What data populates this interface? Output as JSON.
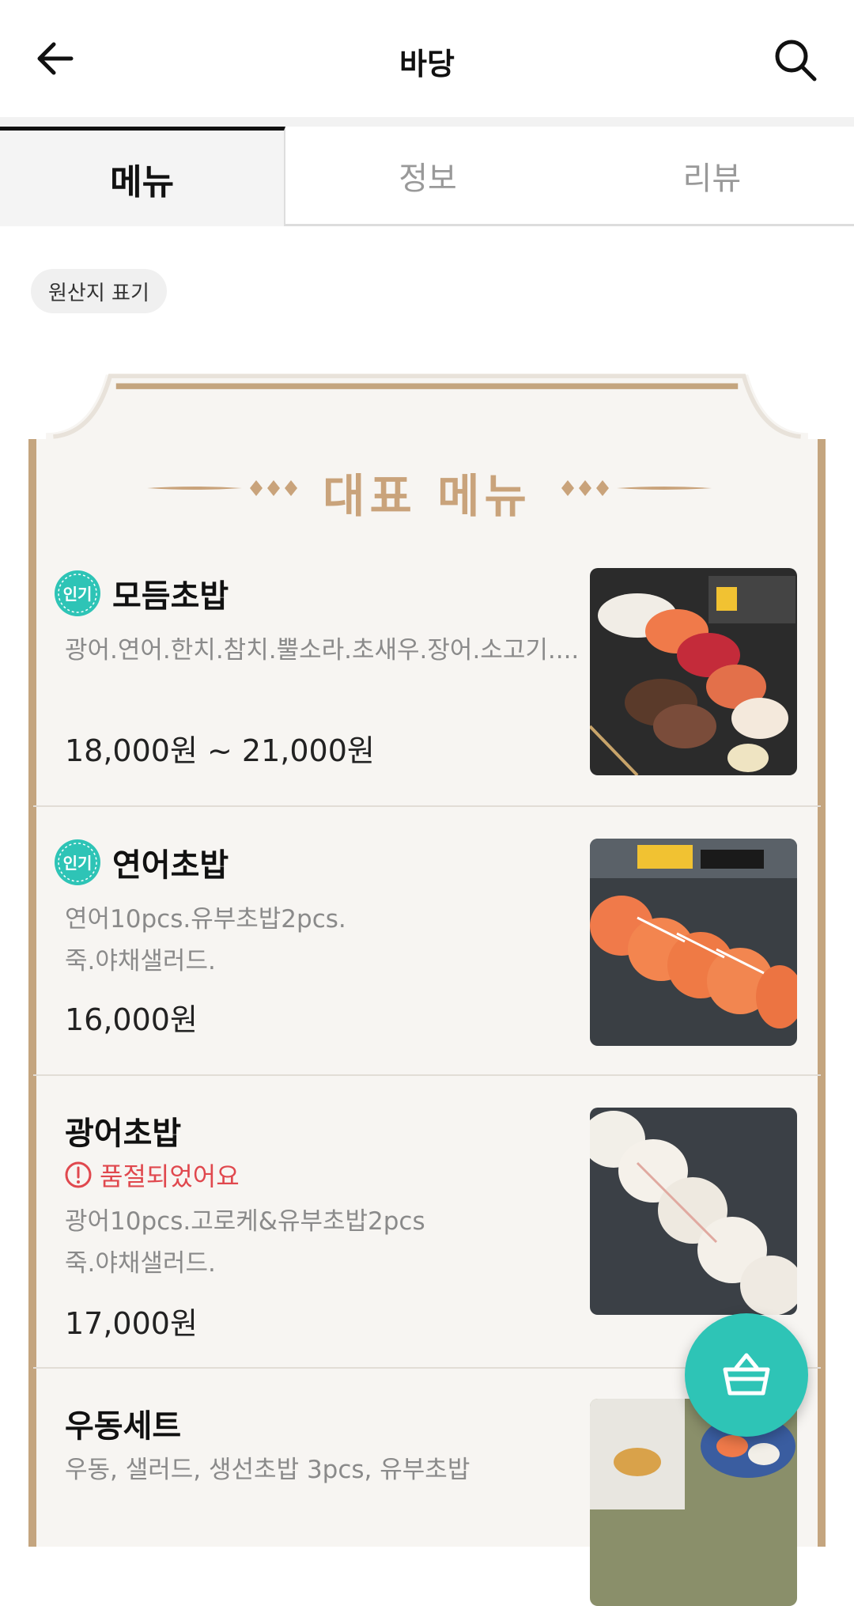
{
  "header": {
    "title": "바당",
    "back_icon": "arrow-left-icon",
    "search_icon": "search-icon"
  },
  "tabs": [
    {
      "label": "메뉴",
      "active": true
    },
    {
      "label": "정보",
      "active": false
    },
    {
      "label": "리뷰",
      "active": false
    }
  ],
  "origin_chip": {
    "label": "원산지 표기"
  },
  "section": {
    "title": "대표 메뉴"
  },
  "menu": [
    {
      "badge": "인기",
      "name": "모듬초밥",
      "desc": "광어.연어.한치.참치.뿔소라.초새우.장어.소고기....",
      "price": "18,000원 ~ 21,000원",
      "sold_out": false
    },
    {
      "badge": "인기",
      "name": "연어초밥",
      "desc": "연어10pcs.유부초밥2pcs.\n죽.야채샐러드.",
      "price": "16,000원",
      "sold_out": false
    },
    {
      "badge": "",
      "name": "광어초밥",
      "status": "품절되었어요",
      "desc": "광어10pcs.고로케&유부초밥2pcs\n죽.야채샐러드.",
      "price": "17,000원",
      "sold_out": true
    },
    {
      "badge": "",
      "name": "우동세트",
      "desc": "우동, 샐러드, 생선초밥 3pcs, 유부초밥",
      "price": "",
      "sold_out": false
    }
  ],
  "colors": {
    "accent": "#2ec4b6",
    "gold": "#c9a37b",
    "soldout": "#e0484e"
  },
  "cart_icon": "basket-icon"
}
